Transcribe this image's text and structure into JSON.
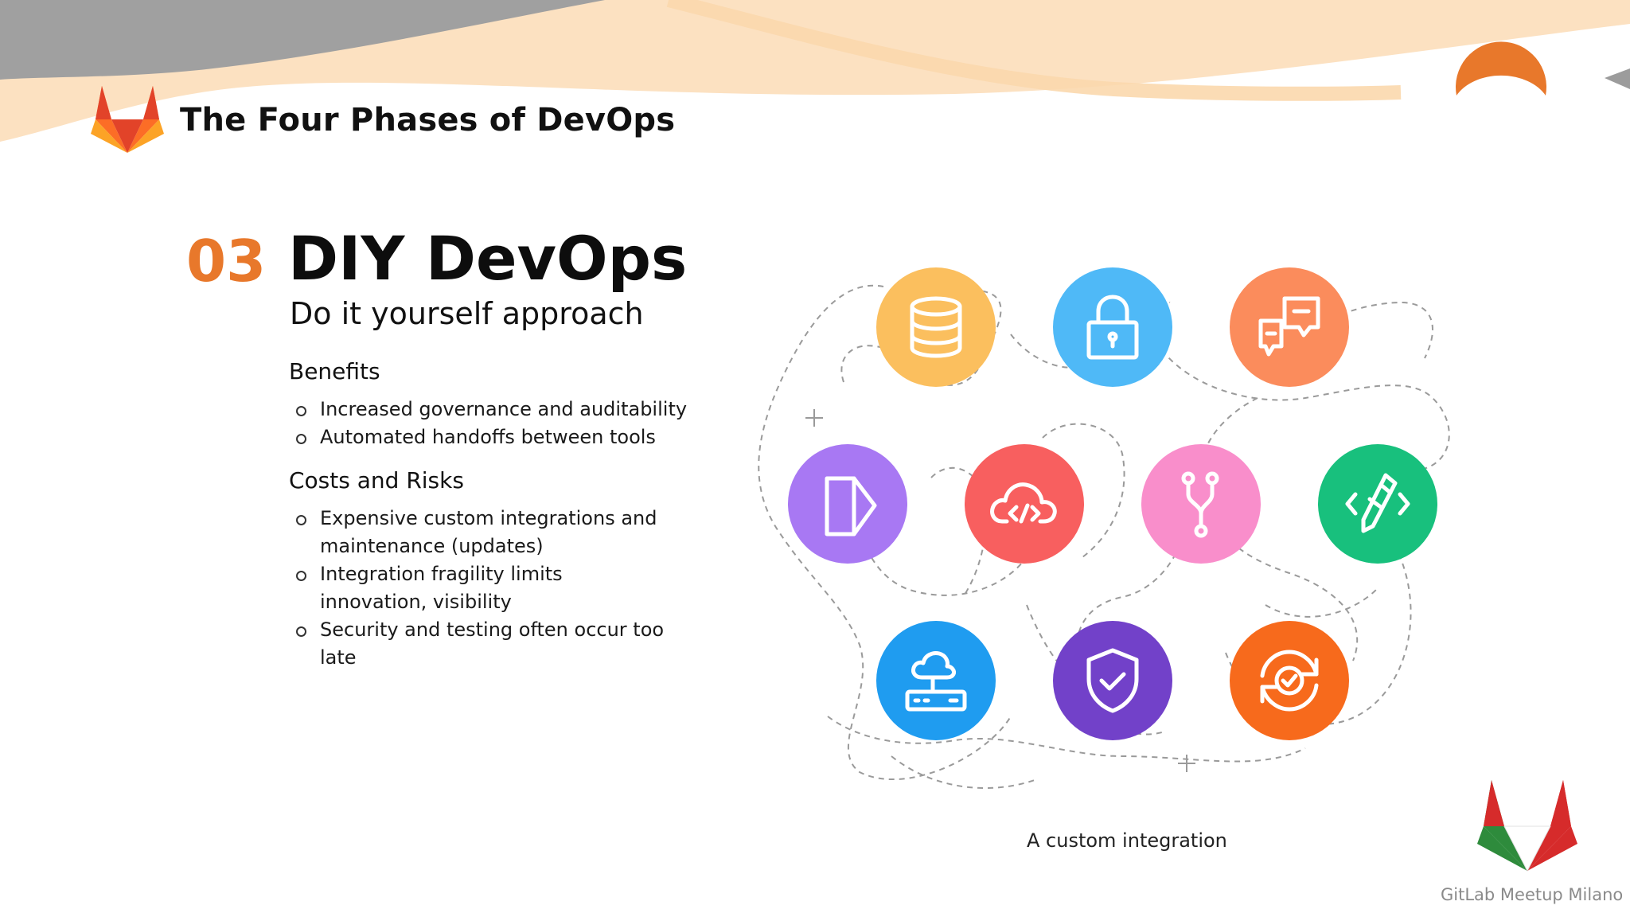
{
  "header": {
    "title": "The Four Phases of DevOps"
  },
  "phase": {
    "number": "03",
    "title": "DIY DevOps",
    "subtitle": "Do it yourself approach"
  },
  "benefits": {
    "heading": "Benefits",
    "items": [
      "Increased governance and auditability",
      "Automated handoffs between tools"
    ]
  },
  "costs": {
    "heading": "Costs and Risks",
    "items": [
      "Expensive custom integrations and maintenance (updates)",
      "Integration fragility limits innovation, visibility",
      "Security and testing often occur too late"
    ]
  },
  "illustration": {
    "caption": "A custom integration",
    "icons": [
      {
        "name": "database-icon",
        "color": "#fbbf5e"
      },
      {
        "name": "lock-icon",
        "color": "#4fb9f7"
      },
      {
        "name": "chat-icon",
        "color": "#fb8c5c"
      },
      {
        "name": "document-icon",
        "color": "#a878f3"
      },
      {
        "name": "cloud-code-icon",
        "color": "#f85f5f"
      },
      {
        "name": "git-branch-icon",
        "color": "#f98ecb"
      },
      {
        "name": "pencil-code-icon",
        "color": "#18c07d"
      },
      {
        "name": "cloud-server-icon",
        "color": "#1f9cf0"
      },
      {
        "name": "shield-check-icon",
        "color": "#7241c9"
      },
      {
        "name": "sync-check-icon",
        "color": "#f76a1c"
      }
    ]
  },
  "footer": {
    "meetup_label": "GitLab Meetup Milano"
  },
  "colors": {
    "accent": "#e8782b",
    "band_gray": "#9c9c9c",
    "band_peach": "#f9c996"
  }
}
